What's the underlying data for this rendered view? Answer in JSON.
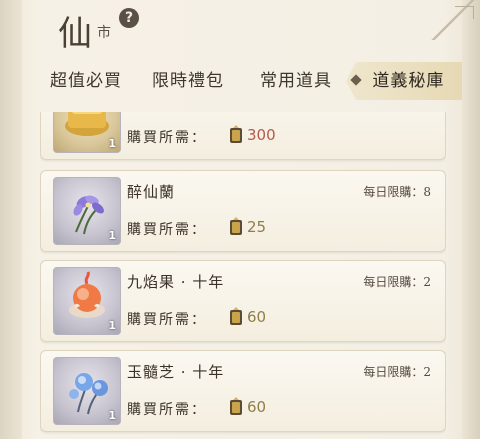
{
  "header": {
    "title": "仙",
    "subtitle": "市",
    "help_icon": "question-circle-icon"
  },
  "tabs": [
    {
      "label": "超值必買",
      "active": false
    },
    {
      "label": "限時禮包",
      "active": false
    },
    {
      "label": "常用道具",
      "active": false
    },
    {
      "label": "道義秘庫",
      "active": true
    }
  ],
  "price_label": "購買所需：",
  "items": [
    {
      "name": "",
      "daily_limit": "",
      "qty": "1",
      "price": "300",
      "icon": "gold-treasure-icon"
    },
    {
      "name": "醉仙蘭",
      "daily_limit": "每日限購：8",
      "qty": "1",
      "price": "25",
      "icon": "purple-orchid-icon"
    },
    {
      "name": "九焰果 · 十年",
      "daily_limit": "每日限購：2",
      "qty": "1",
      "price": "60",
      "icon": "flame-fruit-icon"
    },
    {
      "name": "玉髓芝 · 十年",
      "daily_limit": "每日限購：2",
      "qty": "1",
      "price": "60",
      "icon": "blue-jade-lingzhi-icon"
    }
  ],
  "colors": {
    "price_default": "#8f7e47",
    "price_highlight": "#b45a4a",
    "active_tab_bg": "#e6d9b4"
  }
}
